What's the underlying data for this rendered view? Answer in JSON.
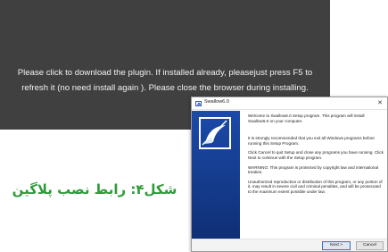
{
  "plugin_banner": {
    "message_line1": "Please click to download the plugin. If installed already, pleasejust press F5 to",
    "message_line2": "refresh it (no need install again ). Please close the browser during installing."
  },
  "caption": "شکل۴: رابط نصب پلاگین",
  "setup_window": {
    "title": "Swallow6.0",
    "close_glyph": "✕",
    "paragraphs": [
      "Welcome to Swallow6.0 Setup program. This program will install Swallow6.0 on your computer.",
      "It is strongly recommended that you exit all Windows programs before running this Setup Program.",
      "Click Cancel to quit Setup and close any programs you have running. Click Next to continue with the Setup program.",
      "WARNING: This program is protected by copyright law and international treaties.",
      "Unauthorized reproduction or distribution of this program, or any portion of it, may result in severe civil and criminal penalties, and will be prosecuted to the maximum extent possible under law."
    ],
    "buttons": {
      "next": "Next >",
      "cancel": "Cancel"
    }
  },
  "colors": {
    "banner_bg": "#404040",
    "caption_green": "#2e9b3a",
    "side_banner_blue": "#153b8c"
  }
}
